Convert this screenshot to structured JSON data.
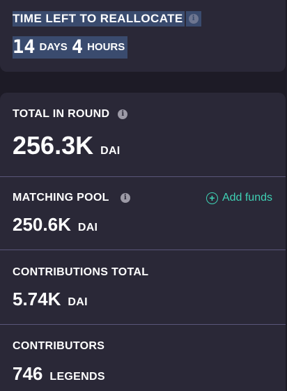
{
  "time_left": {
    "title": "TIME LEFT TO REALLOCATE",
    "days_value": "14",
    "days_unit": "DAYS",
    "hours_value": "4",
    "hours_unit": "HOURS"
  },
  "stats": {
    "total_in_round": {
      "label": "TOTAL IN ROUND",
      "value": "256.3K",
      "unit": "DAI"
    },
    "matching_pool": {
      "label": "MATCHING POOL",
      "value": "250.6K",
      "unit": "DAI",
      "add_funds_label": "Add funds"
    },
    "contributions_total": {
      "label": "CONTRIBUTIONS TOTAL",
      "value": "5.74K",
      "unit": "DAI"
    },
    "contributors": {
      "label": "CONTRIBUTORS",
      "value": "746",
      "unit": "LEGENDS"
    }
  },
  "colors": {
    "background": "#1d1b26",
    "card": "#2a2837",
    "selection_highlight": "#3a4b6e",
    "divider": "#5a577a",
    "accent": "#3fd1b4",
    "info_icon": "#9c9aa6"
  },
  "icons": {
    "info": "info-icon",
    "add": "plus-circle-icon"
  }
}
